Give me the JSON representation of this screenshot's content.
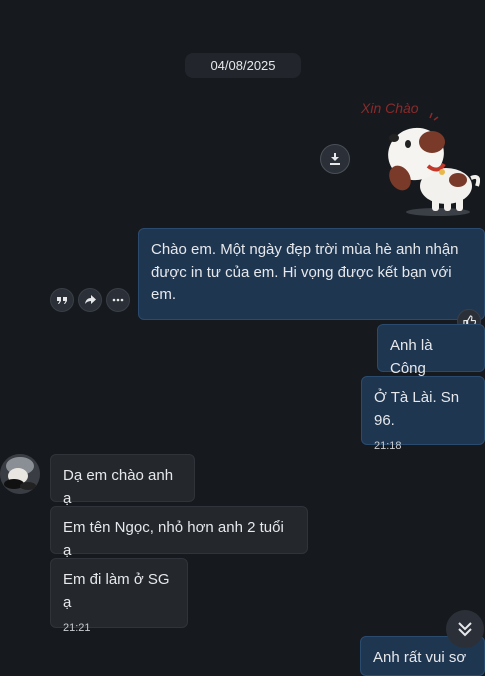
{
  "date_label": "04/08/2025",
  "sticker": {
    "text": "Xin Chào"
  },
  "messages": {
    "m1": "Chào em. Một ngày đẹp trời mùa hè anh nhận được in tư của em. Hi vọng được kết bạn với em.",
    "m2": "Anh là Công",
    "m3": "Ở Tà Lài. Sn 96.",
    "m3_time": "21:18",
    "m4": "Dạ em chào anh ạ",
    "m5": "Em tên Ngọc, nhỏ hơn anh 2 tuổi ạ",
    "m6": "Em đi làm ở SG ạ",
    "m6_time": "21:21",
    "m7_partial": "Anh rất vui sơ CG"
  },
  "icons": {
    "download": "download-icon",
    "quote": "quote-icon",
    "share": "share-icon",
    "more": "more-icon",
    "like": "thumbs-up-icon",
    "scroll_down": "chevron-double-down-icon"
  },
  "colors": {
    "background": "#16191e",
    "outgoing_bubble": "#1f3651",
    "incoming_bubble": "#24272c"
  }
}
